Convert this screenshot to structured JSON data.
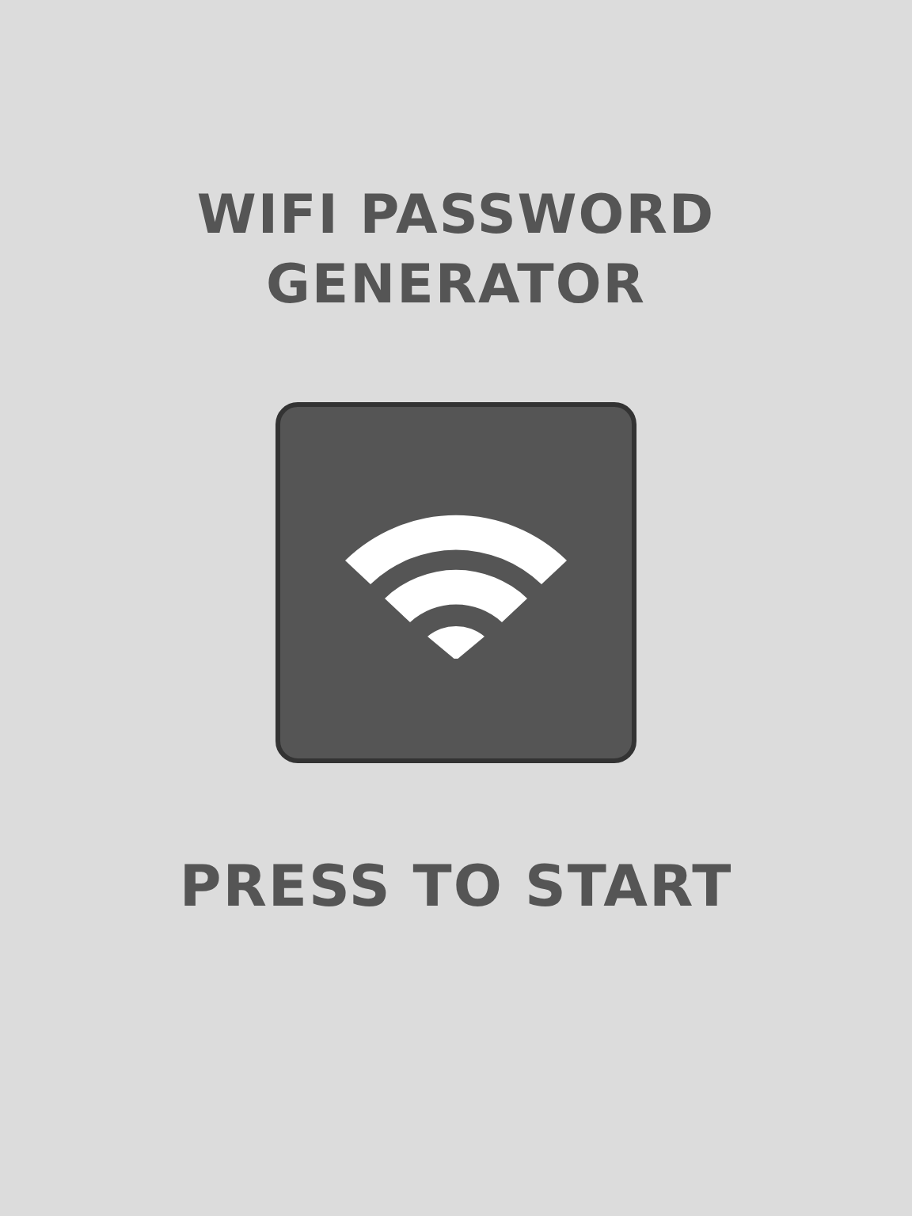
{
  "title_lines": [
    "WIFI PASSWORD",
    "GENERATOR"
  ],
  "start_label": "PRESS TO START"
}
